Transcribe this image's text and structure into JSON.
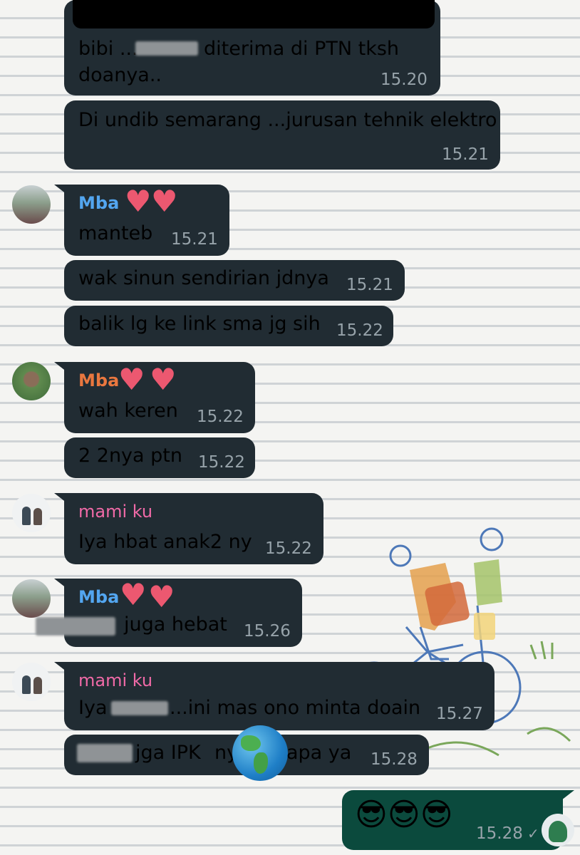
{
  "colors": {
    "bubble_incoming": "#212c33",
    "bubble_outgoing": "#0b4a3d",
    "name_blue": "#53a6f0",
    "name_orange": "#e9773f",
    "name_pink": "#f06aa7",
    "timestamp": "#97a3aa"
  },
  "icons": {
    "censor_heart": "heart-icon",
    "globe_sticker": "globe-icon",
    "read_tick": "check-icon"
  },
  "messages": [
    {
      "text_start": "bibi ...",
      "text_end": "diterima di PTN tksh",
      "text_line2": "doanya..",
      "time": "15.20"
    },
    {
      "text": "Di undib semarang ...jurusan tehnik elektro",
      "time": "15.21"
    },
    {
      "sender": "Mba",
      "text": "manteb",
      "time": "15.21"
    },
    {
      "text": "wak sinun sendirian jdnya",
      "time": "15.21"
    },
    {
      "text": "balik lg ke link sma jg sih",
      "time": "15.22"
    },
    {
      "sender": "Mba",
      "text": "wah keren",
      "time": "15.22"
    },
    {
      "text": "2 2nya ptn",
      "time": "15.22"
    },
    {
      "sender": "mami ku",
      "text": "Iya hbat anak2 ny",
      "time": "15.22"
    },
    {
      "sender": "Mba",
      "text": "juga hebat",
      "time": "15.26"
    },
    {
      "sender": "mami ku",
      "text_start": "Iya",
      "text_end": "...ini mas ono minta doain",
      "time": "15.27"
    },
    {
      "text_start": "jga IPK",
      "text_mid": "ny",
      "text_end": "apa ya",
      "time": "15.28"
    },
    {
      "emoji": "😎😎😎",
      "time": "15.28"
    }
  ]
}
